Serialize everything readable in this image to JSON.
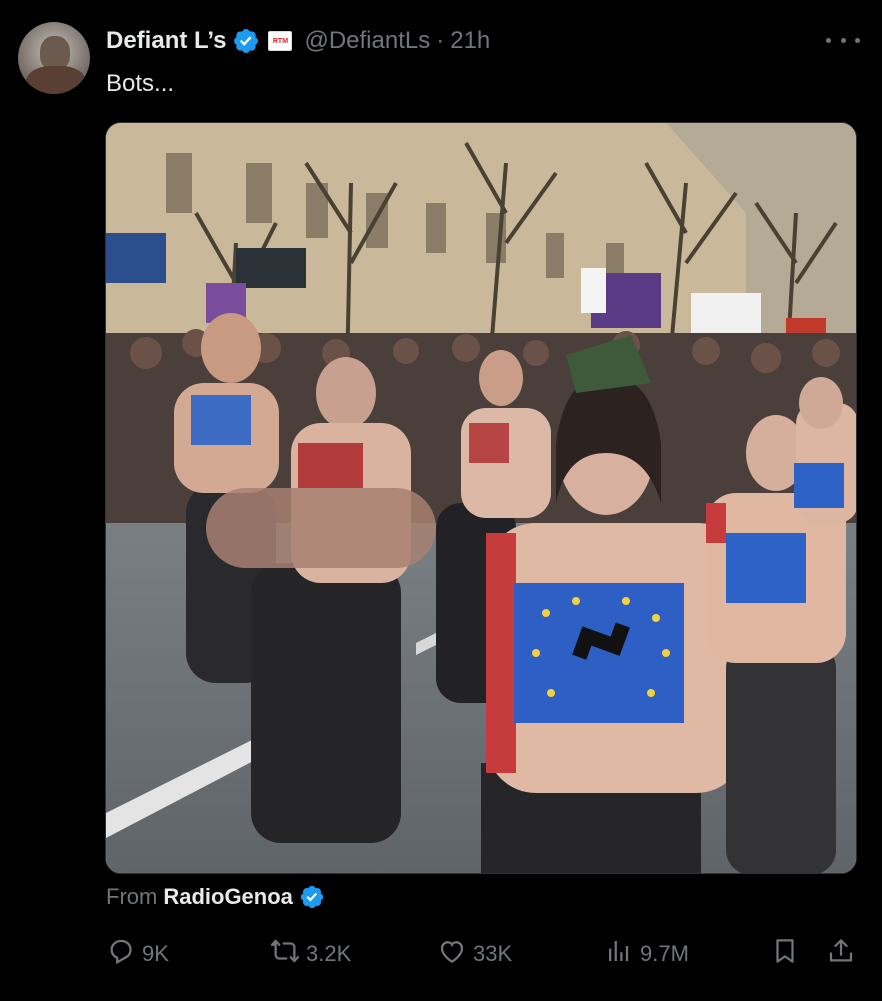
{
  "tweet": {
    "display_name": "Defiant L’s",
    "affiliate_badge_text": "RTM",
    "handle": "@DefiantLs",
    "separator": "·",
    "time": "21h",
    "text": "Bots...",
    "source_prefix": "From",
    "source_account": "RadioGenoa"
  },
  "actions": {
    "replies": "9K",
    "reposts": "3.2K",
    "likes": "33K",
    "views": "9.7M"
  },
  "icons": {
    "avatar": "avatar-photo",
    "verified": "verified-badge-icon",
    "more": "more-options-icon",
    "reply": "reply-icon",
    "repost": "repost-icon",
    "like": "heart-icon",
    "views": "views-chart-icon",
    "bookmark": "bookmark-icon",
    "share": "share-icon"
  },
  "colors": {
    "background": "#000000",
    "text_primary": "#e7e9ea",
    "text_secondary": "#71767b",
    "verified_blue": "#1d9bf0"
  }
}
